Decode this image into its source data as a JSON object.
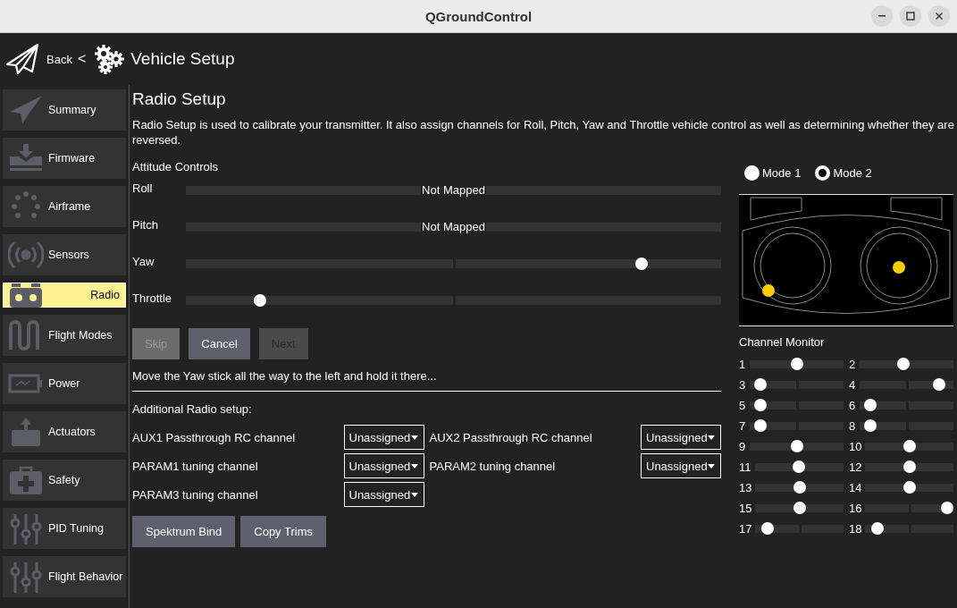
{
  "window": {
    "title": "QGroundControl"
  },
  "header": {
    "back": "Back",
    "separator": "<",
    "title": "Vehicle Setup"
  },
  "sidebar": {
    "items": [
      {
        "label": "Summary",
        "selected": false
      },
      {
        "label": "Firmware",
        "selected": false
      },
      {
        "label": "Airframe",
        "selected": false
      },
      {
        "label": "Sensors",
        "selected": false
      },
      {
        "label": "Radio",
        "selected": true
      },
      {
        "label": "Flight Modes",
        "selected": false
      },
      {
        "label": "Power",
        "selected": false
      },
      {
        "label": "Actuators",
        "selected": false
      },
      {
        "label": "Safety",
        "selected": false
      },
      {
        "label": "PID Tuning",
        "selected": false
      },
      {
        "label": "Flight Behavior",
        "selected": false
      }
    ]
  },
  "page": {
    "title": "Radio Setup",
    "description": "Radio Setup is used to calibrate your transmitter. It also assign channels for Roll, Pitch, Yaw and Throttle vehicle control as well as determining whether they are reversed.",
    "attitude": {
      "heading": "Attitude Controls",
      "rows": [
        {
          "label": "Roll",
          "kind": "unmapped",
          "status": "Not Mapped"
        },
        {
          "label": "Pitch",
          "kind": "unmapped",
          "status": "Not Mapped"
        },
        {
          "label": "Yaw",
          "kind": "mapped",
          "level": 0.86
        },
        {
          "label": "Throttle",
          "kind": "mapped",
          "level": 0.13
        }
      ]
    },
    "buttons": [
      {
        "label": "Skip",
        "disabled": true
      },
      {
        "label": "Cancel",
        "disabled": false
      },
      {
        "label": "Next",
        "disabled": true
      }
    ],
    "instruction": "Move the Yaw stick all the way to the left and hold it there...",
    "additional": {
      "heading": "Additional Radio setup:",
      "options": [
        {
          "label": "AUX1 Passthrough RC channel",
          "value": "Unassigned"
        },
        {
          "label": "AUX2 Passthrough RC channel",
          "value": "Unassigned"
        },
        {
          "label": "PARAM1 tuning channel",
          "value": "Unassigned"
        },
        {
          "label": "PARAM2 tuning channel",
          "value": "Unassigned"
        },
        {
          "label": "PARAM3 tuning channel",
          "value": "Unassigned"
        }
      ]
    },
    "actions": [
      "Spektrum Bind",
      "Copy Trims"
    ]
  },
  "transmitter": {
    "modes": [
      {
        "label": "Mode 1",
        "selected": false
      },
      {
        "label": "Mode 2",
        "selected": true
      }
    ]
  },
  "channel_monitor": {
    "title": "Channel Monitor",
    "channels": [
      {
        "number": "1",
        "level": 0.5
      },
      {
        "number": "2",
        "level": 0.46
      },
      {
        "number": "3",
        "level": 0.06
      },
      {
        "number": "4",
        "level": 0.9
      },
      {
        "number": "5",
        "level": 0.06
      },
      {
        "number": "6",
        "level": 0.06
      },
      {
        "number": "7",
        "level": 0.06
      },
      {
        "number": "8",
        "level": 0.06
      },
      {
        "number": "9",
        "level": 0.5
      },
      {
        "number": "10",
        "level": 0.5
      },
      {
        "number": "11",
        "level": 0.5
      },
      {
        "number": "12",
        "level": 0.5
      },
      {
        "number": "13",
        "level": 0.5
      },
      {
        "number": "14",
        "level": 0.5
      },
      {
        "number": "15",
        "level": 0.5
      },
      {
        "number": "16",
        "level": 1
      },
      {
        "number": "17",
        "level": 0.08
      },
      {
        "number": "18",
        "level": 0.08
      }
    ]
  }
}
